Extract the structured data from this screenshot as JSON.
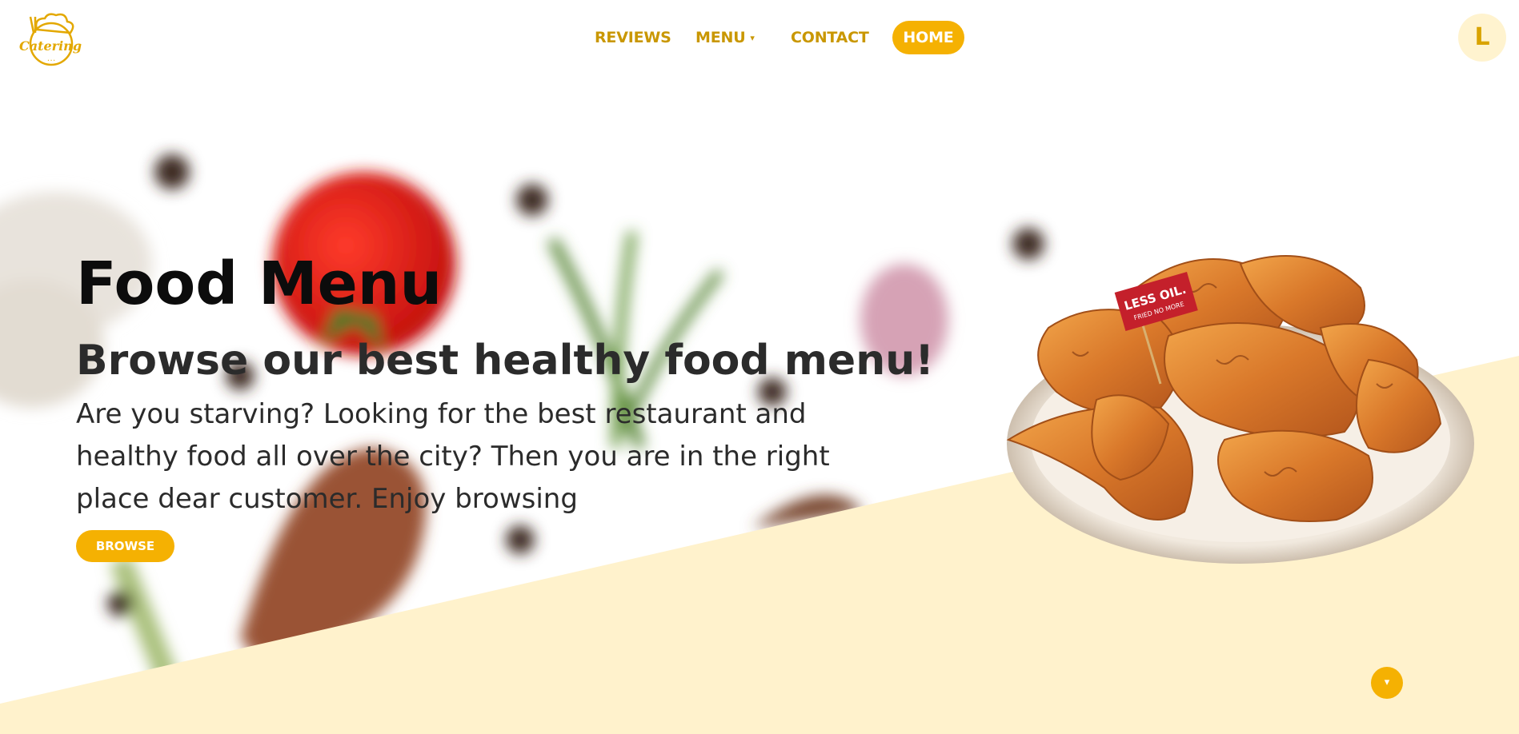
{
  "header": {
    "logo": {
      "text": "Catering",
      "icon": "chef-hat-icon",
      "color": "#e3a800"
    },
    "nav": {
      "reviews": "REVIEWS",
      "menu": "MENU",
      "menu_caret": "▾",
      "contact": "CONTACT",
      "home": "HOME"
    },
    "avatar_initial": "L"
  },
  "hero": {
    "title": "Food Menu",
    "subtitle": "Browse our best healthy food menu!",
    "text": "Are you starving? Looking for the best restaurant and healthy food all over the city? Then you are in the right place dear customer. Enjoy browsing",
    "browse_button": "BROWSE",
    "dish_flag_line1": "LESS OIL.",
    "dish_flag_line2": "FRIED NO MORE"
  },
  "scroll_button": "▾",
  "colors": {
    "accent": "#f5b102",
    "nav_text": "#c99700",
    "cream": "#fff2cc",
    "avatar_bg": "#fff3cf"
  }
}
